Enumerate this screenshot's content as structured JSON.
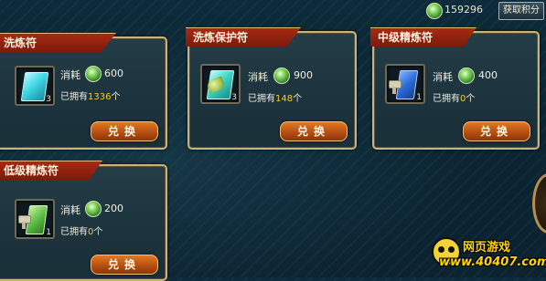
{
  "header": {
    "balance": "159296",
    "redeem_points_label": "获取积分",
    "currency_icon": "green-jade-coin-icon"
  },
  "cards": [
    {
      "title": "洗炼符",
      "cost_label": "消耗",
      "cost": "600",
      "owned_prefix": "已拥有",
      "owned_count": "1336",
      "owned_suffix": "个",
      "qty": "3",
      "button": "兑换",
      "icon": "cyan-talisman-icon"
    },
    {
      "title": "洗炼保护符",
      "cost_label": "消耗",
      "cost": "900",
      "owned_prefix": "已拥有",
      "owned_count": "148",
      "owned_suffix": "个",
      "qty": "3",
      "button": "兑换",
      "icon": "green-leaf-talisman-icon"
    },
    {
      "title": "中级精炼符",
      "cost_label": "消耗",
      "cost": "400",
      "owned_prefix": "已拥有",
      "owned_count": "0",
      "owned_suffix": "个",
      "qty": "1",
      "button": "兑换",
      "icon": "blue-stamp-talisman-icon"
    },
    {
      "title": "低级精炼符",
      "cost_label": "消耗",
      "cost": "200",
      "owned_prefix": "已拥有",
      "owned_count": "0",
      "owned_suffix": "个",
      "qty": "1",
      "button": "兑换",
      "icon": "green-stamp-talisman-icon"
    }
  ],
  "watermark": {
    "title": "网页游戏",
    "url": "www.40407.com"
  },
  "colors": {
    "banner": "#a62a14",
    "border": "#c9b27b",
    "button": "#e07a25",
    "highlight_number": "#f3c93f"
  }
}
